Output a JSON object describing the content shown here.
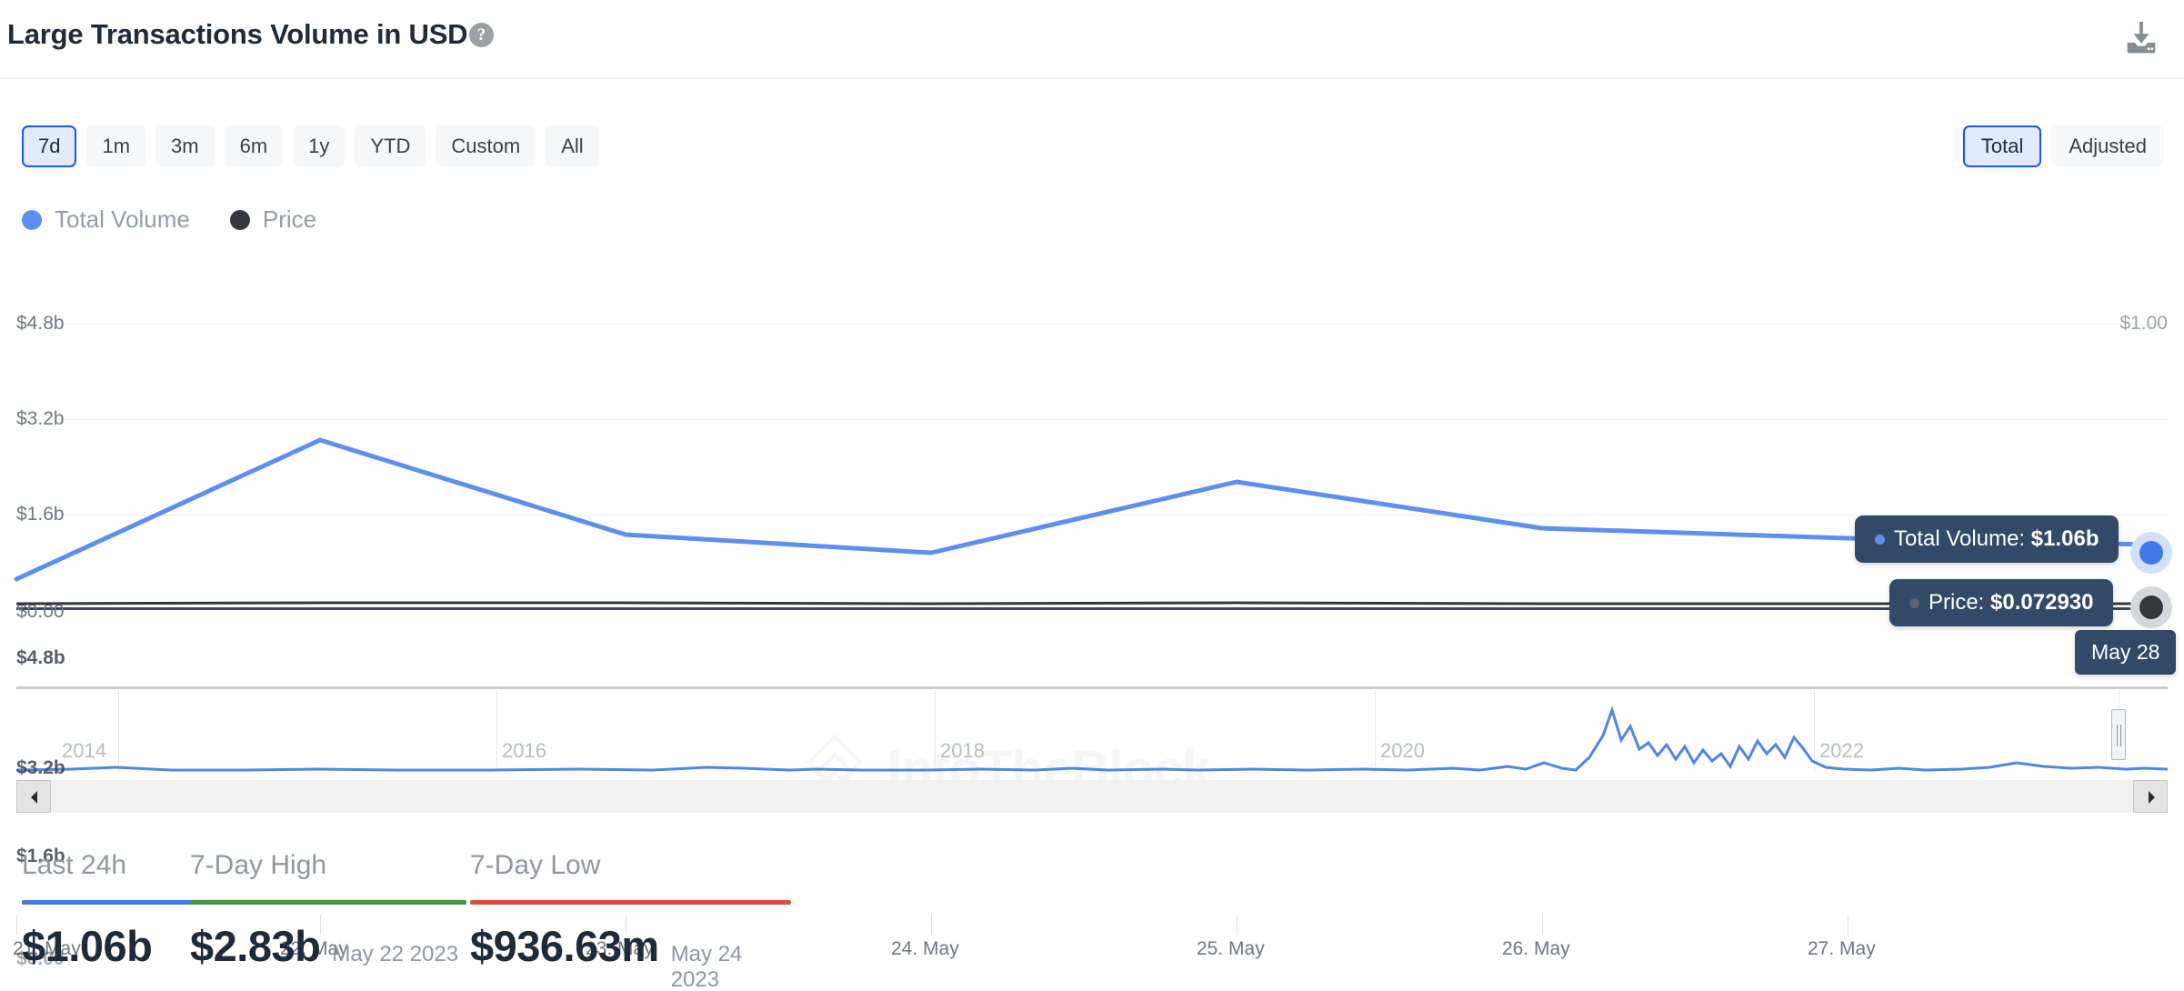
{
  "header": {
    "title": "Large Transactions Volume in USD",
    "help_icon": "question-mark-icon",
    "help_glyph": "?",
    "download_icon": "download-icon"
  },
  "controls": {
    "ranges": [
      {
        "label": "7d",
        "active": true
      },
      {
        "label": "1m",
        "active": false
      },
      {
        "label": "3m",
        "active": false
      },
      {
        "label": "6m",
        "active": false
      },
      {
        "label": "1y",
        "active": false
      },
      {
        "label": "YTD",
        "active": false
      },
      {
        "label": "Custom",
        "active": false
      },
      {
        "label": "All",
        "active": false
      }
    ],
    "modes": [
      {
        "label": "Total",
        "active": true
      },
      {
        "label": "Adjusted",
        "active": false
      }
    ]
  },
  "legend": [
    {
      "label": "Total Volume",
      "color": "#5b8ff0"
    },
    {
      "label": "Price",
      "color": "#33383f"
    }
  ],
  "watermark": {
    "text": "IntoTheBlock"
  },
  "tooltips": {
    "volume": {
      "prefix": "Total Volume:",
      "value": "$1.06b",
      "dot_color": "#5b8ff0"
    },
    "price": {
      "prefix": "Price:",
      "value": "$0.072930",
      "dot_color": "#33383f"
    },
    "date": "May 28"
  },
  "navigator": {
    "years": [
      "2014",
      "2016",
      "2018",
      "2020",
      "2022"
    ],
    "ghost_labels": [
      "$4.8b",
      "$3.2b",
      "$1.6b",
      "$0.00"
    ]
  },
  "scrollbar": {
    "left_arrow": "chevron-left-icon",
    "right_arrow": "chevron-right-icon"
  },
  "stats": [
    {
      "label": "Last 24h",
      "value": "$1.06b",
      "date": "",
      "color": "#3f7ae8"
    },
    {
      "label": "7-Day High",
      "value": "$2.83b",
      "date": "May 22 2023",
      "color": "#3f9a3f"
    },
    {
      "label": "7-Day Low",
      "value": "$936.63m",
      "date": "May 24 2023",
      "color": "#d8503a"
    }
  ],
  "chart_data": {
    "type": "line",
    "title": "Large Transactions Volume in USD",
    "xlabel": "",
    "ylabel": "Total Volume",
    "ylabel_right": "Price",
    "grid": true,
    "legend_position": "top-left",
    "categories": [
      "21. May",
      "22. May",
      "23. May",
      "24. May",
      "25. May",
      "26. May",
      "27. May",
      "May 28"
    ],
    "y_ticks_left": [
      "$0.00",
      "$1.6b",
      "$3.2b",
      "$4.8b"
    ],
    "y_ticks_left_values": [
      0,
      1600000000,
      3200000000,
      4800000000
    ],
    "y_ticks_right": [
      "$1.00"
    ],
    "ylim": [
      0,
      4800000000
    ],
    "ylim_right": [
      0,
      1.0
    ],
    "series": [
      {
        "name": "Total Volume",
        "color": "#5b8ff0",
        "values": [
          0.48,
          2.83,
          1.23,
          0.94,
          1.82,
          1.34,
          1.18,
          1.06
        ],
        "unit": "billions USD"
      },
      {
        "name": "Price",
        "color": "#33383f",
        "values": [
          0.0731,
          0.0735,
          0.0733,
          0.073,
          0.0734,
          0.0732,
          0.0731,
          0.07293
        ],
        "unit": "USD"
      }
    ],
    "highlight": {
      "x": "May 28",
      "volume": "$1.06b",
      "price": "$0.072930"
    },
    "navigator": {
      "type": "area",
      "x_ticks": [
        "2014",
        "2016",
        "2018",
        "2020",
        "2022"
      ],
      "selection": "last 7 days"
    }
  }
}
